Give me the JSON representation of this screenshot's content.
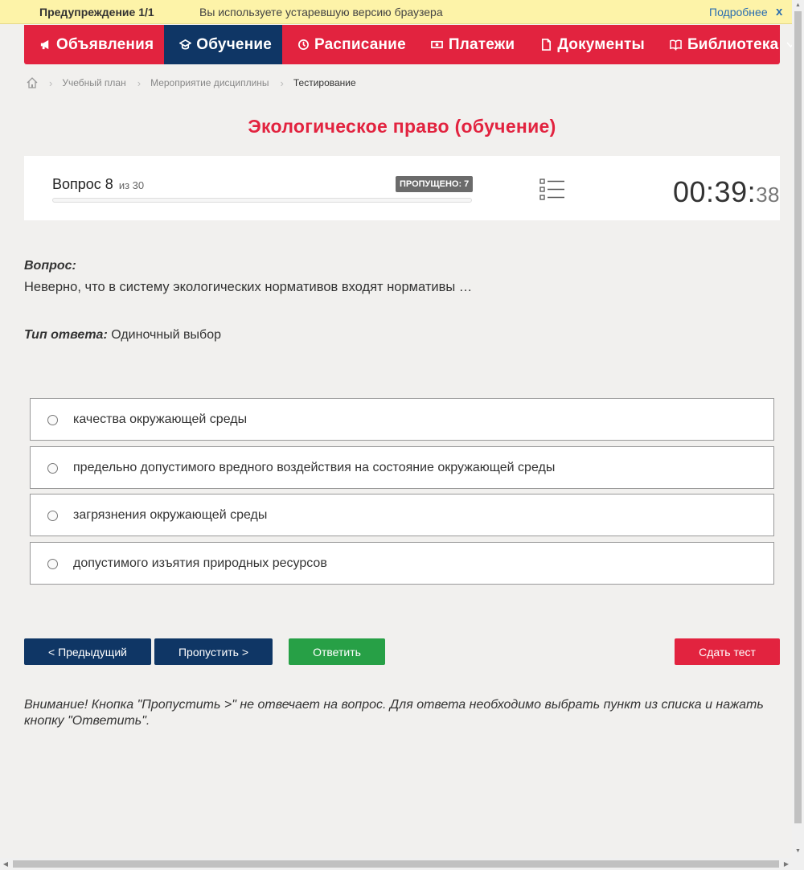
{
  "warning": {
    "title": "Предупреждение 1/1",
    "text": "Вы используете устаревшую версию браузера",
    "more": "Подробнее",
    "close": "x"
  },
  "nav": {
    "items": [
      {
        "label": "Объявления",
        "icon": "megaphone-icon"
      },
      {
        "label": "Обучение",
        "icon": "graduation-cap-icon",
        "active": true
      },
      {
        "label": "Расписание",
        "icon": "clock-icon"
      },
      {
        "label": "Платежи",
        "icon": "money-icon"
      },
      {
        "label": "Документы",
        "icon": "document-icon"
      },
      {
        "label": "Библиотека",
        "icon": "book-icon",
        "dropdown": true
      }
    ],
    "colors": {
      "bar": "#e2233f",
      "active": "#0f3665"
    }
  },
  "breadcrumb": {
    "items": [
      "Учебный план",
      "Мероприятие дисциплины",
      "Тестирование"
    ]
  },
  "page_title": "Экологическое право (обучение)",
  "question_panel": {
    "label": "Вопрос 8",
    "of": "из 30",
    "skipped": "ПРОПУЩЕНО: 7",
    "progress_fraction": 0,
    "timer_main": "00:39:",
    "timer_sec": "38"
  },
  "question": {
    "label": "Вопрос:",
    "text": "Неверно, что в систему экологических нормативов входят нормативы …",
    "type_label": "Тип ответа:",
    "type_value": "Одиночный выбор"
  },
  "options": [
    "качества окружающей среды",
    "предельно допустимого вредного воздействия на состояние окружающей среды",
    "загрязнения окружающей среды",
    "допустимого изъятия природных ресурсов"
  ],
  "buttons": {
    "prev": "< Предыдущий",
    "skip": "Пропустить >",
    "answer": "Ответить",
    "finish": "Сдать тест"
  },
  "note": "Внимание! Кнопка \"Пропустить >\" не отвечает на вопрос. Для ответа необходимо выбрать пункт из списка и нажать кнопку \"Ответить\"."
}
